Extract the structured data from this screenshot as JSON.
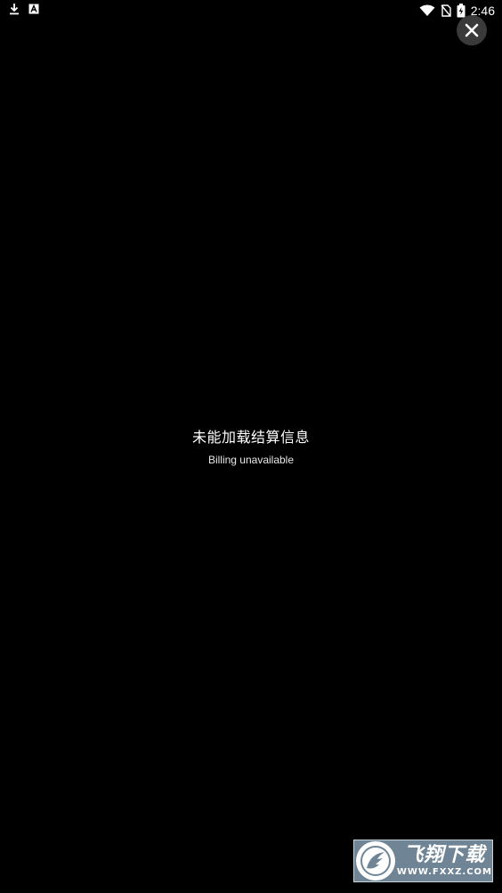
{
  "status_bar": {
    "time": "2:46",
    "left_icons": [
      "download-icon",
      "text-a-icon"
    ],
    "right_icons": [
      "wifi-icon",
      "no-sim-icon",
      "battery-charging-icon"
    ]
  },
  "close_button": {
    "icon": "close-icon"
  },
  "message": {
    "title": "未能加载结算信息",
    "subtitle": "Billing unavailable"
  },
  "watermark": {
    "brand_cn": "飞翔下载",
    "url": "WWW.FXXZ.COM",
    "background_color": "#6f8596"
  },
  "colors": {
    "background": "#000000",
    "text": "#ffffff",
    "close_button_bg": "#3a3a3a"
  }
}
